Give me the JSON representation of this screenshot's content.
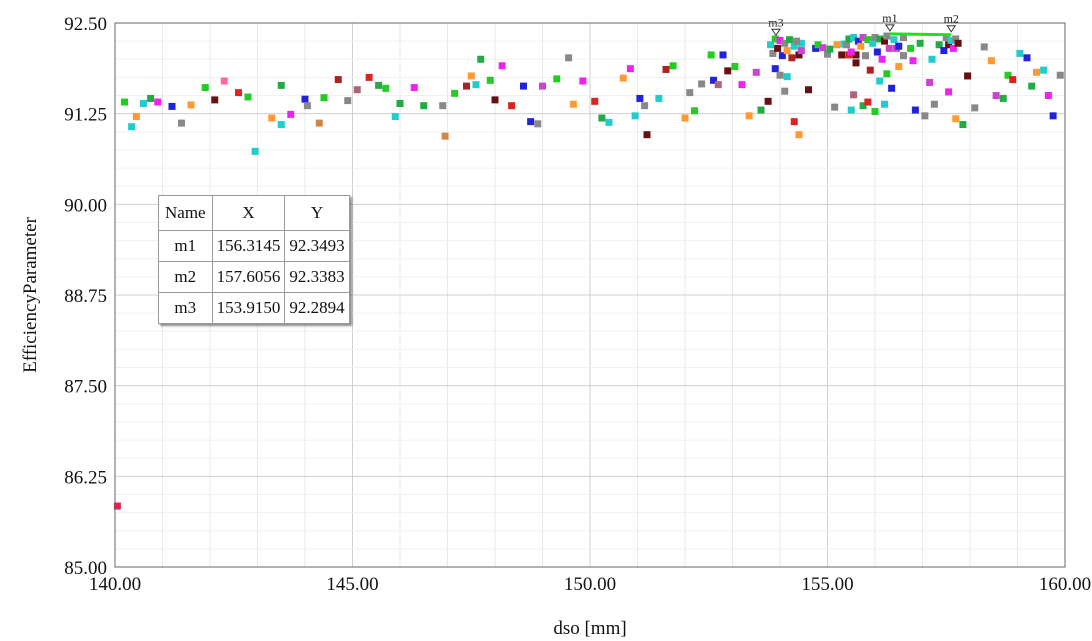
{
  "chart_data": {
    "type": "scatter",
    "xlabel": "dso [mm]",
    "ylabel": "EfficiencyParameter",
    "xlim": [
      140,
      160
    ],
    "ylim": [
      85,
      92.5
    ],
    "x_ticks": [
      "140.00",
      "145.00",
      "150.00",
      "155.00",
      "160.00"
    ],
    "y_ticks": [
      "85.00",
      "86.25",
      "87.50",
      "88.75",
      "90.00",
      "91.25",
      "92.50"
    ],
    "grid": true,
    "legend": "none",
    "points": [
      [
        140.05,
        85.84,
        "#e02050"
      ],
      [
        140.2,
        91.41,
        "#22cc22"
      ],
      [
        140.35,
        91.07,
        "#22cccc"
      ],
      [
        140.45,
        91.21,
        "#ff9933"
      ],
      [
        140.6,
        91.39,
        "#22cccc"
      ],
      [
        140.75,
        91.46,
        "#22aa44"
      ],
      [
        140.9,
        91.41,
        "#ee22ee"
      ],
      [
        141.2,
        91.35,
        "#2222dd"
      ],
      [
        141.4,
        91.12,
        "#888888"
      ],
      [
        141.6,
        91.37,
        "#ff9933"
      ],
      [
        141.9,
        91.61,
        "#22cc22"
      ],
      [
        142.1,
        91.44,
        "#661111"
      ],
      [
        142.3,
        91.7,
        "#ff66aa"
      ],
      [
        142.6,
        91.54,
        "#dd2222"
      ],
      [
        142.8,
        91.48,
        "#22cc22"
      ],
      [
        142.95,
        90.73,
        "#22cccc"
      ],
      [
        143.3,
        91.19,
        "#ff9933"
      ],
      [
        143.5,
        91.1,
        "#22cccc"
      ],
      [
        143.5,
        91.64,
        "#22aa44"
      ],
      [
        143.7,
        91.24,
        "#ee22ee"
      ],
      [
        144.0,
        91.45,
        "#2222dd"
      ],
      [
        144.05,
        91.36,
        "#888888"
      ],
      [
        144.3,
        91.12,
        "#cc8844"
      ],
      [
        144.4,
        91.47,
        "#22cc22"
      ],
      [
        144.7,
        91.72,
        "#aa2222"
      ],
      [
        144.9,
        91.43,
        "#888888"
      ],
      [
        145.1,
        91.58,
        "#aa6677"
      ],
      [
        145.35,
        91.75,
        "#dd2222"
      ],
      [
        145.55,
        91.64,
        "#22aa44"
      ],
      [
        145.7,
        91.6,
        "#22cc22"
      ],
      [
        145.9,
        91.21,
        "#22cccc"
      ],
      [
        146.0,
        91.39,
        "#22aa44"
      ],
      [
        146.3,
        91.61,
        "#ee22ee"
      ],
      [
        146.5,
        91.36,
        "#22aa44"
      ],
      [
        146.9,
        91.36,
        "#888888"
      ],
      [
        146.95,
        90.94,
        "#cc8844"
      ],
      [
        147.15,
        91.53,
        "#22cc22"
      ],
      [
        147.4,
        91.63,
        "#aa2222"
      ],
      [
        147.5,
        91.77,
        "#ff9933"
      ],
      [
        147.6,
        91.65,
        "#22cccc"
      ],
      [
        147.7,
        92.0,
        "#22aa44"
      ],
      [
        147.9,
        91.71,
        "#22cc22"
      ],
      [
        148.0,
        91.44,
        "#661111"
      ],
      [
        148.15,
        91.91,
        "#ee22ee"
      ],
      [
        148.35,
        91.36,
        "#dd2222"
      ],
      [
        148.6,
        91.63,
        "#2222dd"
      ],
      [
        148.75,
        91.14,
        "#2222dd"
      ],
      [
        148.9,
        91.11,
        "#888888"
      ],
      [
        149.0,
        91.63,
        "#cc44cc"
      ],
      [
        149.3,
        91.73,
        "#22cc22"
      ],
      [
        149.55,
        92.02,
        "#888888"
      ],
      [
        149.65,
        91.38,
        "#ff9933"
      ],
      [
        149.85,
        91.7,
        "#ee22ee"
      ],
      [
        150.1,
        91.42,
        "#dd2222"
      ],
      [
        150.25,
        91.19,
        "#22aa44"
      ],
      [
        150.4,
        91.13,
        "#22cccc"
      ],
      [
        150.7,
        91.74,
        "#ff9933"
      ],
      [
        150.85,
        91.87,
        "#ee22ee"
      ],
      [
        150.95,
        91.22,
        "#22cccc"
      ],
      [
        151.05,
        91.46,
        "#2222dd"
      ],
      [
        151.15,
        91.36,
        "#888888"
      ],
      [
        151.2,
        90.96,
        "#661111"
      ],
      [
        151.45,
        91.46,
        "#22cccc"
      ],
      [
        151.6,
        91.86,
        "#aa2222"
      ],
      [
        151.75,
        91.91,
        "#22cc22"
      ],
      [
        152.0,
        91.19,
        "#ff9933"
      ],
      [
        152.1,
        91.54,
        "#888888"
      ],
      [
        152.2,
        91.29,
        "#22cc22"
      ],
      [
        152.35,
        91.66,
        "#888888"
      ],
      [
        152.55,
        92.06,
        "#22cc22"
      ],
      [
        152.6,
        91.71,
        "#2222dd"
      ],
      [
        152.7,
        91.65,
        "#aa6677"
      ],
      [
        152.8,
        92.06,
        "#2222dd"
      ],
      [
        152.9,
        91.84,
        "#661111"
      ],
      [
        153.05,
        91.9,
        "#22cc22"
      ],
      [
        153.2,
        91.65,
        "#ee22ee"
      ],
      [
        153.35,
        91.22,
        "#ff9933"
      ],
      [
        153.5,
        91.82,
        "#cc44cc"
      ],
      [
        153.6,
        91.3,
        "#22aa44"
      ],
      [
        153.75,
        91.42,
        "#661111"
      ],
      [
        153.9,
        91.87,
        "#2222dd"
      ],
      [
        154.0,
        91.78,
        "#888888"
      ],
      [
        154.1,
        91.56,
        "#888888"
      ],
      [
        154.15,
        91.76,
        "#22cccc"
      ],
      [
        154.3,
        91.14,
        "#dd2222"
      ],
      [
        154.4,
        90.96,
        "#ff9933"
      ],
      [
        154.45,
        92.22,
        "#22cccc"
      ],
      [
        154.6,
        91.58,
        "#661111"
      ],
      [
        154.75,
        92.15,
        "#2222dd"
      ],
      [
        154.8,
        92.2,
        "#22cc22"
      ],
      [
        154.9,
        92.16,
        "#cc44cc"
      ],
      [
        155.0,
        92.07,
        "#888888"
      ],
      [
        155.05,
        92.14,
        "#22aa44"
      ],
      [
        155.15,
        91.34,
        "#888888"
      ],
      [
        155.2,
        92.2,
        "#ff9933"
      ],
      [
        155.3,
        92.06,
        "#661111"
      ],
      [
        155.35,
        92.21,
        "#22cccc"
      ],
      [
        155.45,
        92.06,
        "#dd2222"
      ],
      [
        155.5,
        91.3,
        "#22cccc"
      ],
      [
        155.55,
        91.51,
        "#aa6677"
      ],
      [
        155.6,
        92.06,
        "#661111"
      ],
      [
        155.75,
        91.36,
        "#22aa44"
      ],
      [
        155.85,
        91.41,
        "#dd2222"
      ],
      [
        156.0,
        91.28,
        "#22cc22"
      ],
      [
        156.1,
        91.7,
        "#22cccc"
      ],
      [
        156.2,
        91.38,
        "#22cccc"
      ],
      [
        156.25,
        91.8,
        "#22cc22"
      ],
      [
        156.35,
        91.6,
        "#2222dd"
      ],
      [
        156.45,
        92.15,
        "#cc44cc"
      ],
      [
        156.5,
        91.9,
        "#ff9933"
      ],
      [
        156.6,
        92.05,
        "#888888"
      ],
      [
        156.75,
        92.15,
        "#22cc22"
      ],
      [
        156.8,
        91.98,
        "#ee22ee"
      ],
      [
        156.85,
        91.3,
        "#2222dd"
      ],
      [
        156.95,
        92.22,
        "#22aa44"
      ],
      [
        157.05,
        91.22,
        "#888888"
      ],
      [
        157.15,
        91.68,
        "#cc44cc"
      ],
      [
        157.2,
        92.0,
        "#22cccc"
      ],
      [
        157.25,
        91.38,
        "#888888"
      ],
      [
        157.35,
        92.2,
        "#22aa44"
      ],
      [
        157.45,
        92.12,
        "#2222dd"
      ],
      [
        157.55,
        91.55,
        "#ee22ee"
      ],
      [
        157.7,
        91.18,
        "#ff9933"
      ],
      [
        157.85,
        91.1,
        "#22aa44"
      ],
      [
        157.95,
        91.77,
        "#661111"
      ],
      [
        158.1,
        91.33,
        "#888888"
      ],
      [
        158.3,
        92.17,
        "#888888"
      ],
      [
        158.45,
        91.98,
        "#ff9933"
      ],
      [
        158.55,
        91.5,
        "#cc44cc"
      ],
      [
        158.7,
        91.46,
        "#22aa44"
      ],
      [
        158.8,
        91.78,
        "#22cc22"
      ],
      [
        158.9,
        91.72,
        "#dd2222"
      ],
      [
        159.05,
        92.08,
        "#22cccc"
      ],
      [
        159.2,
        92.02,
        "#2222dd"
      ],
      [
        159.3,
        91.63,
        "#22aa44"
      ],
      [
        159.4,
        91.82,
        "#ff9933"
      ],
      [
        159.55,
        91.85,
        "#22cccc"
      ],
      [
        159.65,
        91.5,
        "#ee22ee"
      ],
      [
        159.75,
        91.22,
        "#2222dd"
      ],
      [
        159.9,
        91.78,
        "#888888"
      ]
    ],
    "cluster_points": [
      [
        153.8,
        92.2,
        "#22cccc"
      ],
      [
        153.85,
        92.08,
        "#888888"
      ],
      [
        153.9,
        92.28,
        "#22cc22"
      ],
      [
        153.95,
        92.15,
        "#661111"
      ],
      [
        154.0,
        92.26,
        "#ee22ee"
      ],
      [
        154.05,
        92.05,
        "#2222dd"
      ],
      [
        154.1,
        92.22,
        "#888888"
      ],
      [
        154.15,
        92.12,
        "#ff9933"
      ],
      [
        154.2,
        92.27,
        "#22aa44"
      ],
      [
        154.25,
        92.02,
        "#aa2222"
      ],
      [
        154.3,
        92.18,
        "#22cccc"
      ],
      [
        154.35,
        92.25,
        "#888888"
      ],
      [
        154.4,
        92.06,
        "#661111"
      ],
      [
        154.45,
        92.12,
        "#cc44cc"
      ],
      [
        155.4,
        92.2,
        "#888888"
      ],
      [
        155.45,
        92.28,
        "#22aa44"
      ],
      [
        155.5,
        92.1,
        "#ee22ee"
      ],
      [
        155.55,
        92.3,
        "#22cccc"
      ],
      [
        155.6,
        91.95,
        "#661111"
      ],
      [
        155.65,
        92.25,
        "#2222dd"
      ],
      [
        155.7,
        92.18,
        "#ff9933"
      ],
      [
        155.75,
        92.3,
        "#cc44cc"
      ],
      [
        155.8,
        92.05,
        "#888888"
      ],
      [
        155.85,
        92.27,
        "#22cc22"
      ],
      [
        155.9,
        91.85,
        "#aa2222"
      ],
      [
        155.95,
        92.22,
        "#22cccc"
      ],
      [
        156.0,
        92.3,
        "#888888"
      ],
      [
        156.05,
        92.1,
        "#2222dd"
      ],
      [
        156.1,
        92.28,
        "#22aa44"
      ],
      [
        156.15,
        92.0,
        "#ee22ee"
      ],
      [
        156.2,
        92.25,
        "#661111"
      ],
      [
        156.25,
        92.32,
        "#888888"
      ],
      [
        156.3,
        92.15,
        "#cc44cc"
      ],
      [
        156.4,
        92.27,
        "#22cccc"
      ],
      [
        156.5,
        92.18,
        "#2222dd"
      ],
      [
        156.6,
        92.3,
        "#888888"
      ],
      [
        157.5,
        92.3,
        "#888888"
      ],
      [
        157.55,
        92.2,
        "#661111"
      ],
      [
        157.6,
        92.26,
        "#22cccc"
      ],
      [
        157.65,
        92.15,
        "#ee22ee"
      ],
      [
        157.7,
        92.28,
        "#888888"
      ],
      [
        157.75,
        92.22,
        "#661111"
      ]
    ],
    "green_line": [
      [
        156.3145,
        92.3493
      ],
      [
        157.6056,
        92.3383
      ]
    ],
    "markers": [
      {
        "name": "m1",
        "x": 156.3145,
        "y": 92.3493
      },
      {
        "name": "m2",
        "x": 157.6056,
        "y": 92.3383
      },
      {
        "name": "m3",
        "x": 153.915,
        "y": 92.2894
      }
    ],
    "marker_table": {
      "headers": [
        "Name",
        "X",
        "Y"
      ],
      "rows": [
        [
          "m1",
          "156.3145",
          "92.3493"
        ],
        [
          "m2",
          "157.6056",
          "92.3383"
        ],
        [
          "m3",
          "153.9150",
          "92.2894"
        ]
      ]
    }
  }
}
